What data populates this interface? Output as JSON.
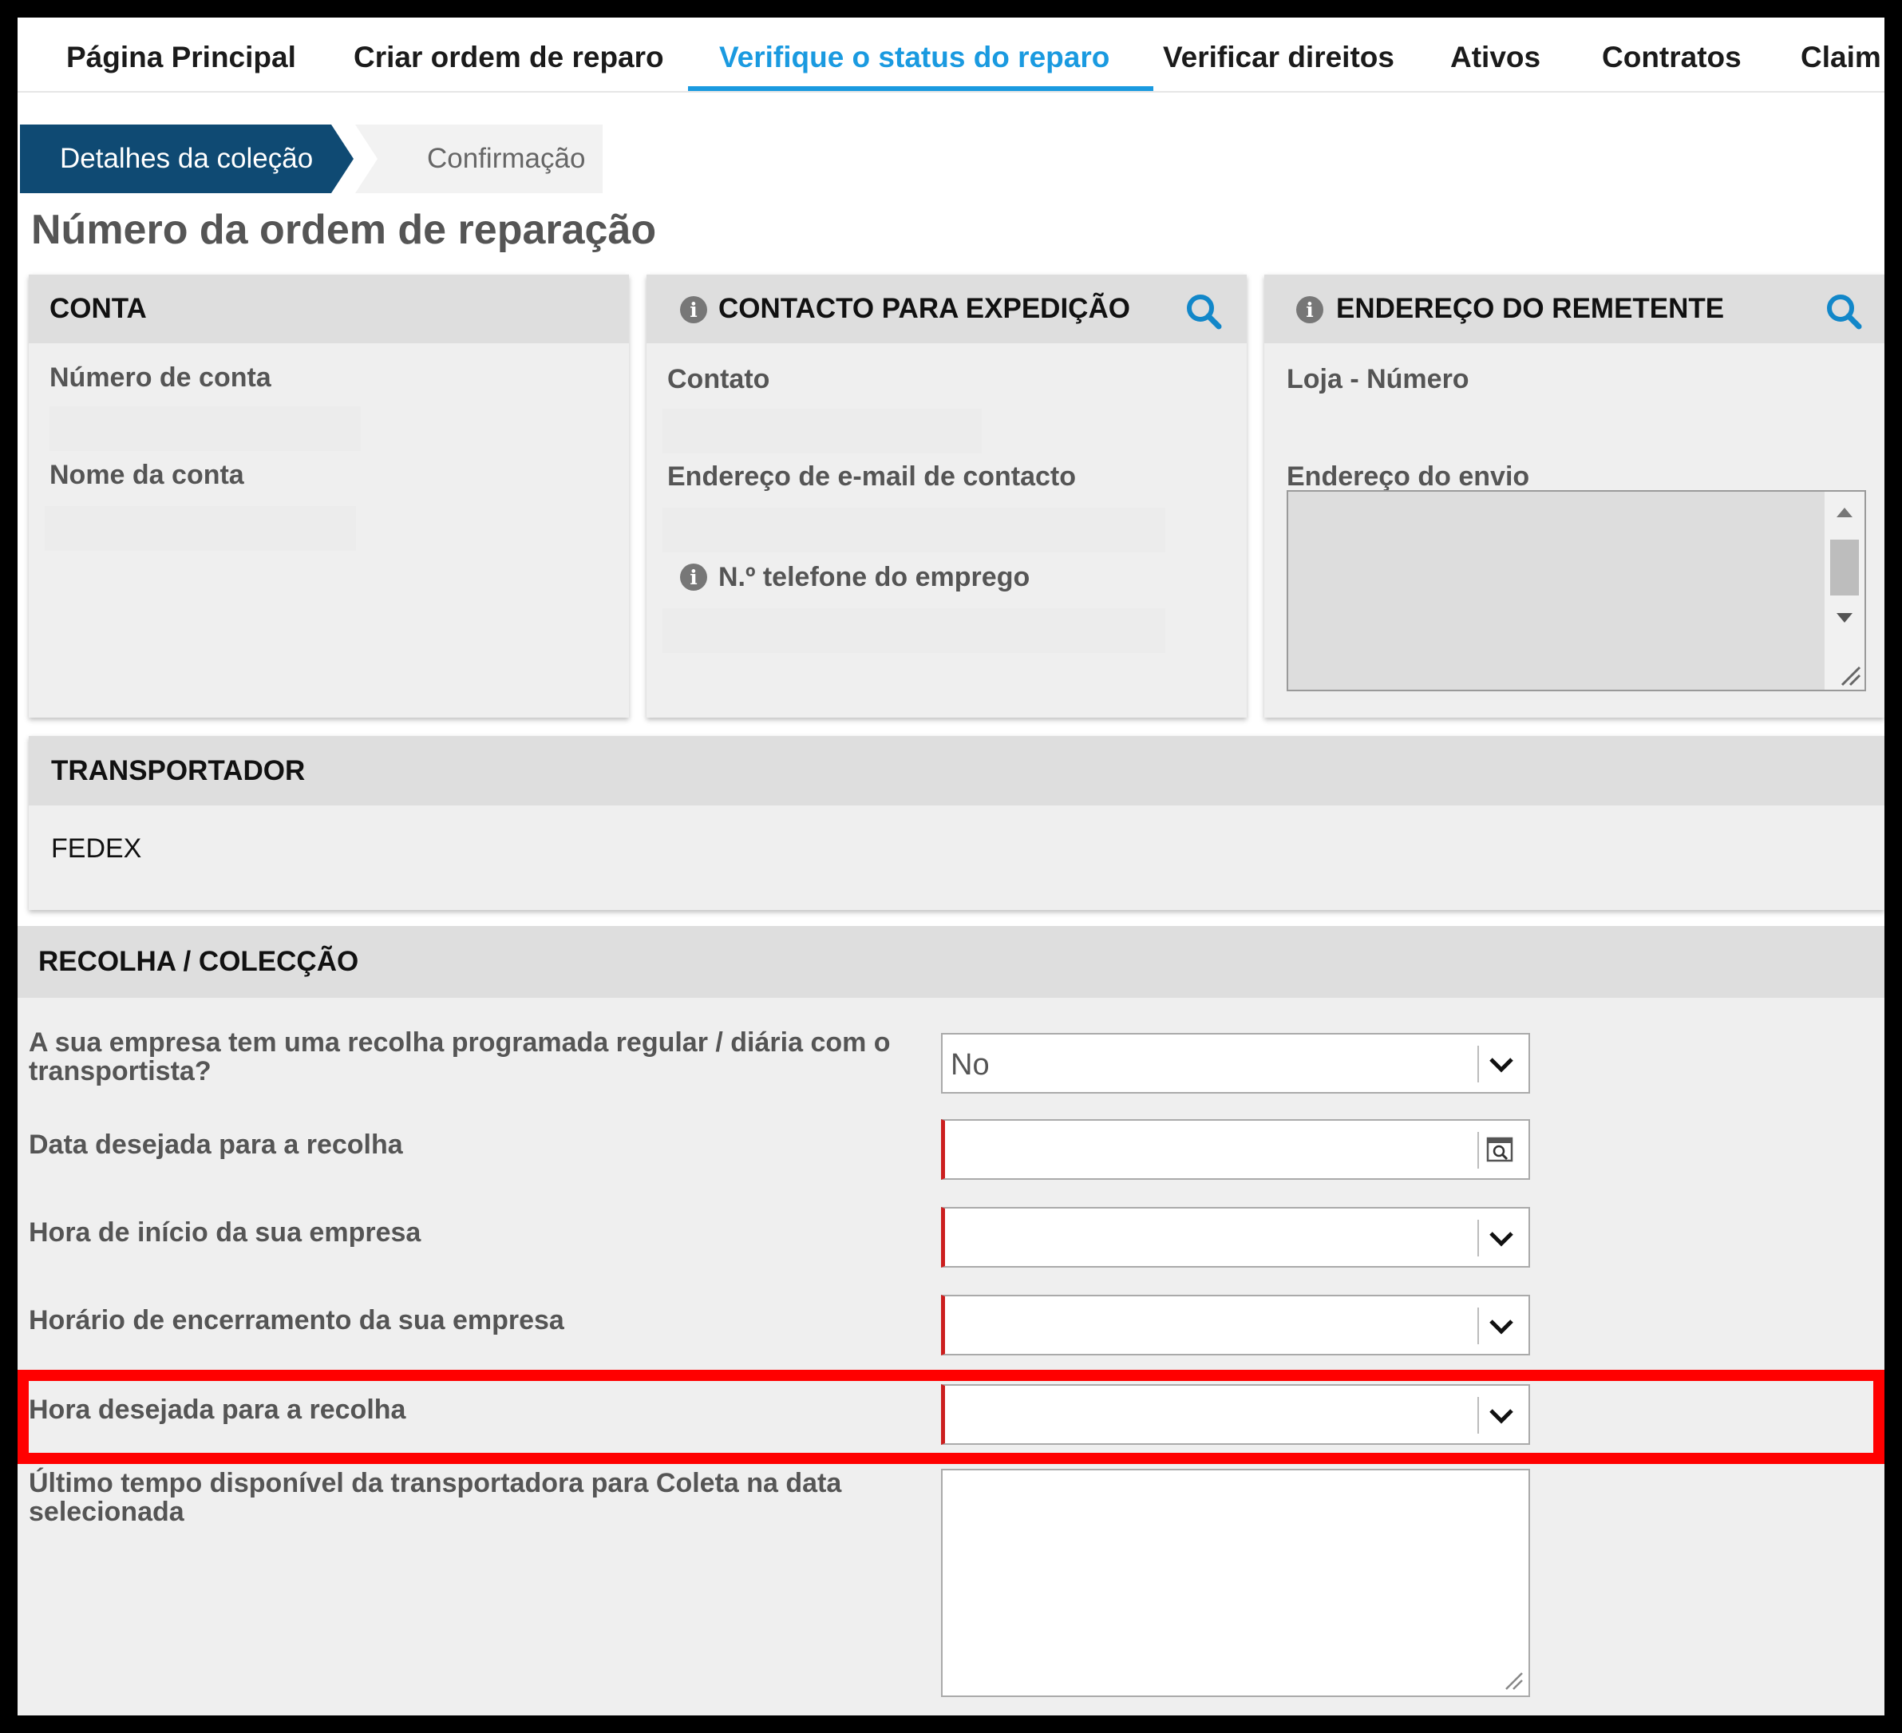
{
  "nav": {
    "tabs": [
      {
        "label": "Página Principal"
      },
      {
        "label": "Criar ordem de reparo"
      },
      {
        "label": "Verifique o status do reparo",
        "active": true
      },
      {
        "label": "Verificar direitos"
      },
      {
        "label": "Ativos"
      },
      {
        "label": "Contratos"
      },
      {
        "label": "Claim"
      }
    ]
  },
  "wizard": {
    "steps": [
      {
        "label": "Detalhes da coleção",
        "active": true
      },
      {
        "label": "Confirmação",
        "active": false
      }
    ]
  },
  "page_title": "Número da ordem de reparação",
  "account_panel": {
    "title": "CONTA",
    "fields": {
      "account_number_label": "Número de conta",
      "account_name_label": "Nome da conta"
    }
  },
  "shipping_contact_panel": {
    "title": "CONTACTO PARA EXPEDIÇÃO",
    "fields": {
      "contact_label": "Contato",
      "email_label": "Endereço de e-mail de contacto",
      "phone_label": "N.º telefone do emprego"
    }
  },
  "sender_address_panel": {
    "title": "ENDEREÇO DO REMETENTE",
    "fields": {
      "store_number_label": "Loja - Número",
      "shipping_address_label": "Endereço do envio"
    }
  },
  "carrier_panel": {
    "title": "TRANSPORTADOR",
    "value": "FEDEX"
  },
  "collection_form": {
    "title": "RECOLHA / COLECÇÃO",
    "scheduled_pickup": {
      "label": "A sua empresa tem uma recolha programada regular / diária com o transportista?",
      "value": "No"
    },
    "pickup_date": {
      "label": "Data desejada para a recolha",
      "value": ""
    },
    "business_start": {
      "label": "Hora de início da sua empresa",
      "value": ""
    },
    "business_close": {
      "label": "Horário de encerramento da sua empresa",
      "value": ""
    },
    "pickup_time": {
      "label": "Hora desejada para a recolha",
      "value": ""
    },
    "last_available": {
      "label": "Último tempo disponível da transportadora para Coleta na data selecionada",
      "value": ""
    }
  },
  "colors": {
    "accent": "#1a9ae0",
    "wizard_active": "#0f4a73",
    "search_icon": "#1287c9",
    "required_marker": "#cc1f1f",
    "highlight": "#ff0000"
  },
  "icons": [
    "info-icon",
    "search-icon",
    "chevron-down-icon",
    "calendar-icon",
    "resize-grip-icon"
  ]
}
